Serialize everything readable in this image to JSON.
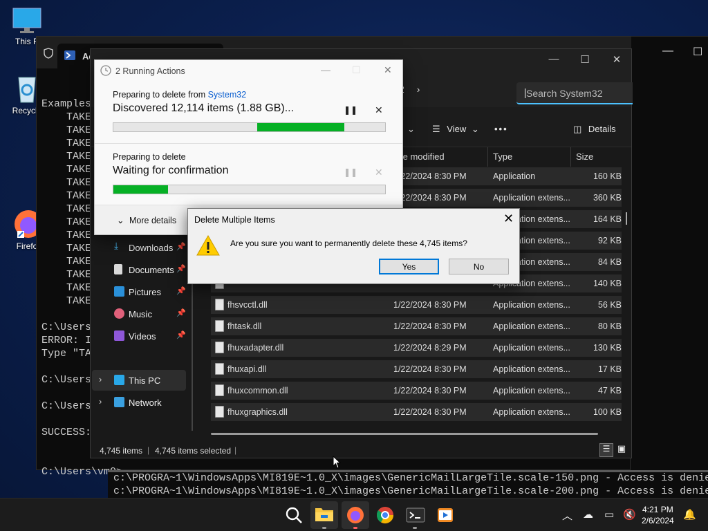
{
  "desktop": {
    "icons": [
      {
        "label": "This P"
      },
      {
        "label": "Recycle"
      },
      {
        "label": "Firefo"
      }
    ]
  },
  "terminal": {
    "tab_title": "Ac",
    "lines_left": [
      "Examples",
      "    TAKE",
      "    TAKE",
      "    TAKE",
      "    TAKE",
      "    TAKE",
      "    TAKE",
      "    TAKE",
      "    TAKE",
      "    TAKE",
      "    TAKE",
      "    TAKE",
      "    TAKE",
      "    TAKE",
      "    TAKE",
      "    TAKE"
    ],
    "lines_left2": [
      "C:\\Users",
      "ERROR: I",
      "Type \"TA",
      "",
      "C:\\Users",
      "",
      "C:\\Users",
      "",
      "SUCCESS:",
      "",
      "",
      "C:\\Users\\vm0>"
    ],
    "bottom_lines": [
      "c:\\PROGRA~1\\WindowsApps\\MI819E~1.0_X\\images\\GenericMailLargeTile.scale-150.png - Access is denie",
      "c:\\PROGRA~1\\WindowsApps\\MI819E~1.0_X\\images\\GenericMailLargeTile.scale-200.png - Access is denie"
    ]
  },
  "explorer": {
    "breadcrumb_tail": "2",
    "search_placeholder": "Search System32",
    "view_label": "View",
    "details_label": "Details",
    "columns": {
      "date": "te modified",
      "type": "Type",
      "size": "Size"
    },
    "rows": [
      {
        "name": "",
        "date": "1/22/2024 8:30 PM",
        "type": "Application",
        "size": "160 KB"
      },
      {
        "name": "",
        "date": "1/22/2024 8:30 PM",
        "type": "Application extens...",
        "size": "360 KB"
      },
      {
        "name": "",
        "date": "",
        "type": "Application extens...",
        "size": "164 KB"
      },
      {
        "name": "",
        "date": "",
        "type": "Application extens...",
        "size": "92 KB"
      },
      {
        "name": "",
        "date": "",
        "type": "Application extens...",
        "size": "84 KB"
      },
      {
        "name": "",
        "date": "",
        "type": "Application extens...",
        "size": "140 KB"
      },
      {
        "name": "fhsvcctl.dll",
        "date": "1/22/2024 8:30 PM",
        "type": "Application extens...",
        "size": "56 KB"
      },
      {
        "name": "fhtask.dll",
        "date": "1/22/2024 8:30 PM",
        "type": "Application extens...",
        "size": "80 KB"
      },
      {
        "name": "fhuxadapter.dll",
        "date": "1/22/2024 8:29 PM",
        "type": "Application extens...",
        "size": "130 KB"
      },
      {
        "name": "fhuxapi.dll",
        "date": "1/22/2024 8:30 PM",
        "type": "Application extens...",
        "size": "17 KB"
      },
      {
        "name": "fhuxcommon.dll",
        "date": "1/22/2024 8:30 PM",
        "type": "Application extens...",
        "size": "47 KB"
      },
      {
        "name": "fhuxgraphics.dll",
        "date": "1/22/2024 8:30 PM",
        "type": "Application extens...",
        "size": "100 KB"
      }
    ],
    "nav": [
      {
        "label": "Downloads",
        "pinned": true
      },
      {
        "label": "Documents",
        "pinned": true
      },
      {
        "label": "Pictures",
        "pinned": true
      },
      {
        "label": "Music",
        "pinned": true
      },
      {
        "label": "Videos",
        "pinned": true
      },
      {
        "label": "This PC",
        "pinned": false
      },
      {
        "label": "Network",
        "pinned": false
      }
    ],
    "status_items": "4,745 items",
    "status_selected": "4,745 items selected"
  },
  "progress": {
    "title": "2 Running Actions",
    "op1": {
      "prefix": "Preparing to delete from ",
      "link": "System32",
      "status": "Discovered 12,114 items (1.88 GB)...",
      "fill_start": 0.53,
      "fill_end": 0.85
    },
    "op2": {
      "prefix": "Preparing to delete",
      "status": "Waiting for confirmation",
      "fill_start": 0.0,
      "fill_end": 0.2
    },
    "more_details": "More details"
  },
  "dialog": {
    "title": "Delete Multiple Items",
    "message": "Are you sure you want to permanently delete these 4,745 items?",
    "yes": "Yes",
    "no": "No"
  },
  "taskbar": {
    "time": "4:21 PM",
    "date": "2/6/2024"
  }
}
